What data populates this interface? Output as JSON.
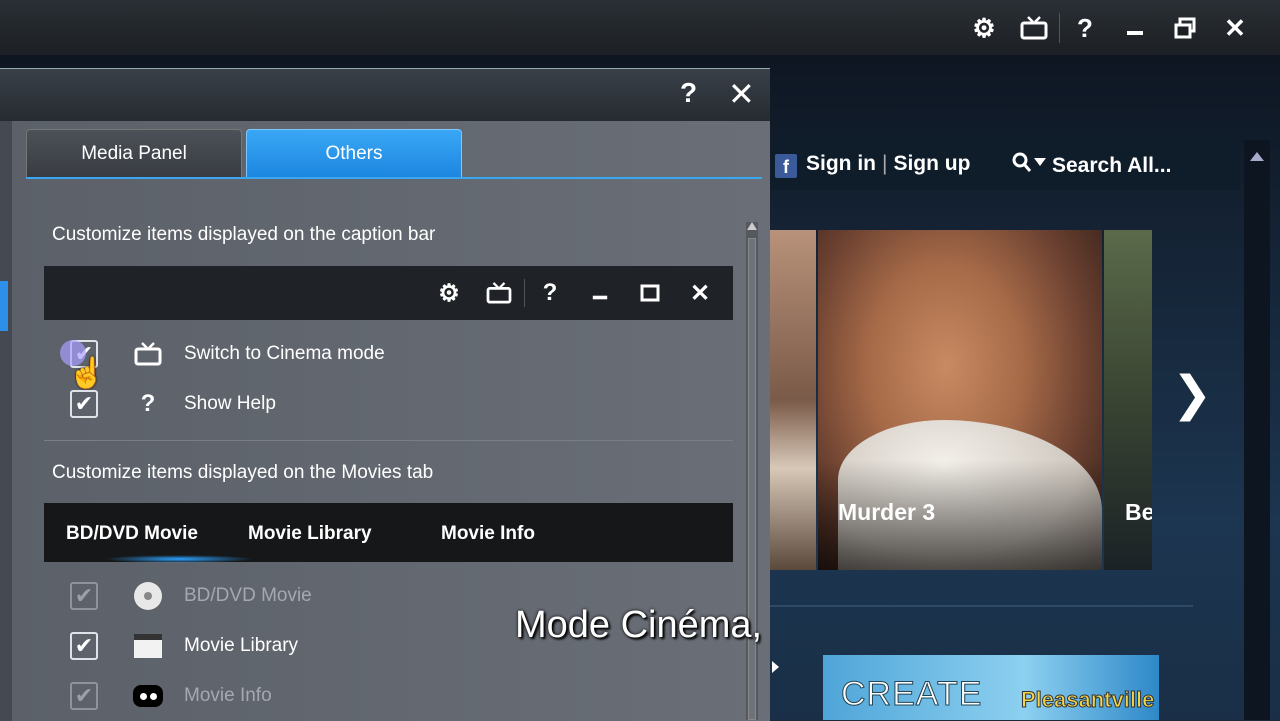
{
  "app": {
    "caption_icons": [
      "gear-icon",
      "cinema-tv-icon",
      "help-icon",
      "minimize-icon",
      "restore-icon",
      "close-icon"
    ]
  },
  "background": {
    "sign_in": "Sign in",
    "sign_up": "Sign up",
    "search_placeholder": "Search All...",
    "movies": [
      {
        "title": ""
      },
      {
        "title": "Murder 3"
      },
      {
        "title": "Be"
      }
    ],
    "promo_text": "CREATE",
    "promo_title": "Pleasantville"
  },
  "dialog": {
    "help": "?",
    "close": "✕",
    "tabs": [
      {
        "label": "Media Panel",
        "active": false
      },
      {
        "label": "Others",
        "active": true
      }
    ],
    "caption_section_label": "Customize items displayed on the caption bar",
    "preview_icons": [
      "gear-icon",
      "cinema-tv-icon",
      "help-icon",
      "minimize-icon",
      "maximize-icon",
      "close-icon"
    ],
    "caption_options": [
      {
        "label": "Switch to Cinema mode",
        "checked": true,
        "icon": "cinema-tv-icon"
      },
      {
        "label": "Show Help",
        "checked": true,
        "icon": "help-icon"
      }
    ],
    "movies_section_label": "Customize items displayed on the Movies tab",
    "movies_tabs": [
      {
        "label": "BD/DVD Movie",
        "active": true
      },
      {
        "label": "Movie Library",
        "active": false
      },
      {
        "label": "Movie Info",
        "active": false
      }
    ],
    "movies_options": [
      {
        "label": "BD/DVD Movie",
        "checked": true,
        "enabled": false,
        "icon": "disc-icon"
      },
      {
        "label": "Movie Library",
        "checked": true,
        "enabled": true,
        "icon": "clapperboard-icon"
      },
      {
        "label": "Movie Info",
        "checked": true,
        "enabled": false,
        "icon": "info-glasses-icon"
      }
    ]
  },
  "subtitle": "Mode Cinéma,"
}
